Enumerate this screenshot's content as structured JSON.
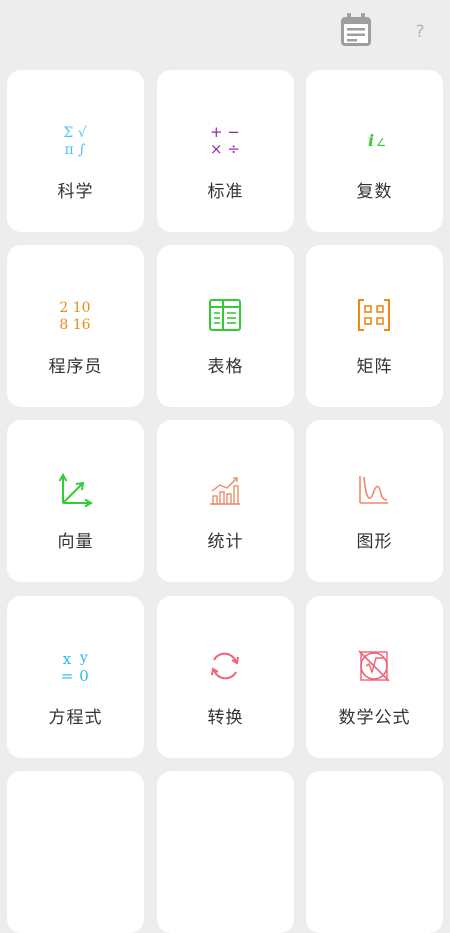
{
  "header": {
    "help_label": "?"
  },
  "colors": {
    "background": "#ededee",
    "card": "#ffffff",
    "label": "#333333",
    "scientific": "#4fc3f7",
    "standard": "#9c27b0",
    "complex": "#33cc33",
    "programmer": "#ef8a17",
    "spreadsheet": "#33cc33",
    "matrix": "#ef8a17",
    "vector": "#33cc33",
    "statistics": "#ef8a6b",
    "graph": "#ef8a6b",
    "equation": "#29b6f6",
    "conversion": "#f06277",
    "formula": "#f06277"
  },
  "icons": {
    "scientific": {
      "row1": "Σ √",
      "row2": "π ∫"
    },
    "standard": {
      "row1": "+ −",
      "row2": "× ÷"
    },
    "complex": {
      "main": "i",
      "angle": "∠"
    },
    "programmer": {
      "row1": "2 10",
      "row2": "8 16"
    },
    "equation": {
      "row1a": "x",
      "row1b": "y",
      "row2a": "=",
      "row2b": "0"
    }
  },
  "cards": [
    {
      "id": "scientific",
      "label": "科学",
      "icon": "sigma-sqrt-pi-integral-icon"
    },
    {
      "id": "standard",
      "label": "标准",
      "icon": "arithmetic-operators-icon"
    },
    {
      "id": "complex",
      "label": "复数",
      "icon": "complex-number-icon"
    },
    {
      "id": "programmer",
      "label": "程序员",
      "icon": "number-bases-icon"
    },
    {
      "id": "spreadsheet",
      "label": "表格",
      "icon": "spreadsheet-icon"
    },
    {
      "id": "matrix",
      "label": "矩阵",
      "icon": "matrix-brackets-icon"
    },
    {
      "id": "vector",
      "label": "向量",
      "icon": "vector-axes-icon"
    },
    {
      "id": "statistics",
      "label": "统计",
      "icon": "bar-chart-trend-icon"
    },
    {
      "id": "graph",
      "label": "图形",
      "icon": "function-curve-icon"
    },
    {
      "id": "equation",
      "label": "方程式",
      "icon": "equation-icon"
    },
    {
      "id": "conversion",
      "label": "转换",
      "icon": "refresh-arrows-icon"
    },
    {
      "id": "formula",
      "label": "数学公式",
      "icon": "math-formula-icon"
    }
  ]
}
